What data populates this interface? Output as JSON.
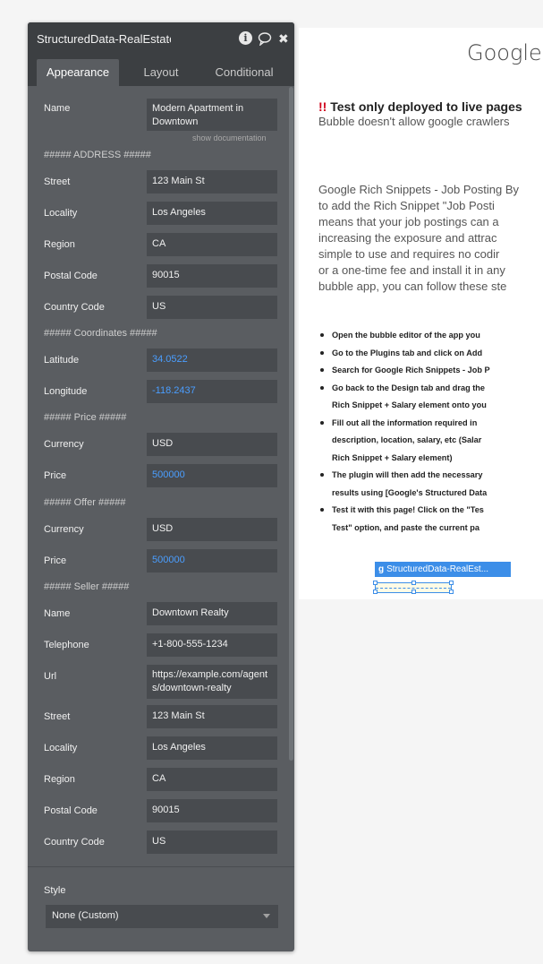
{
  "panel": {
    "title": "StructuredData-RealEstate",
    "tabs": [
      "Appearance",
      "Layout",
      "Conditional"
    ],
    "show_doc": "show documentation",
    "sections": {
      "address": "##### ADDRESS #####",
      "coordinates": "##### Coordinates #####",
      "price": "##### Price #####",
      "offer": "##### Offer #####",
      "seller": "##### Seller #####"
    },
    "fields": {
      "name": {
        "label": "Name",
        "value": "Modern Apartment in Downtown"
      },
      "street": {
        "label": "Street",
        "value": "123 Main St"
      },
      "locality": {
        "label": "Locality",
        "value": "Los Angeles"
      },
      "region": {
        "label": "Region",
        "value": "CA"
      },
      "postal": {
        "label": "Postal Code",
        "value": "90015"
      },
      "country": {
        "label": "Country Code",
        "value": "US"
      },
      "latitude": {
        "label": "Latitude",
        "value": "34.0522"
      },
      "longitude": {
        "label": "Longitude",
        "value": "-118.2437"
      },
      "currency": {
        "label": "Currency",
        "value": "USD"
      },
      "price": {
        "label": "Price",
        "value": "500000"
      },
      "offer_currency": {
        "label": "Currency",
        "value": "USD"
      },
      "offer_price": {
        "label": "Price",
        "value": "500000"
      },
      "seller_name": {
        "label": "Name",
        "value": "Downtown Realty"
      },
      "telephone": {
        "label": "Telephone",
        "value": "+1-800-555-1234"
      },
      "url": {
        "label": "Url",
        "value": "https://example.com/agents/downtown-realty"
      },
      "seller_street": {
        "label": "Street",
        "value": "123 Main St"
      },
      "seller_locality": {
        "label": "Locality",
        "value": "Los Angeles"
      },
      "seller_region": {
        "label": "Region",
        "value": "CA"
      },
      "seller_postal": {
        "label": "Postal Code",
        "value": "90015"
      },
      "seller_country": {
        "label": "Country Code",
        "value": "US"
      }
    },
    "style": {
      "label": "Style",
      "value": "None (Custom)"
    }
  },
  "page": {
    "title": "Google",
    "warning_mark": "!!",
    "warning": "Test only deployed to live pages",
    "note": "Bubble doesn't allow google crawlers",
    "paragraph": [
      "Google Rich Snippets - Job Posting By",
      "to add the Rich Snippet \"Job Posti",
      "means that your job postings can a",
      "increasing the exposure and attrac",
      "simple to use and requires no codir",
      "or a one-time fee and install it in any",
      "bubble app, you can follow these ste"
    ],
    "steps": [
      [
        "Open the bubble editor of the app you"
      ],
      [
        "Go to the Plugins tab and click on Add"
      ],
      [
        "Search for Google Rich Snippets - Job P"
      ],
      [
        "Go back to the Design tab and drag the",
        "Rich Snippet + Salary element onto you"
      ],
      [
        "Fill out all the information required in",
        "description, location, salary, etc (Salar",
        "Rich Snippet + Salary element)"
      ],
      [
        "The plugin will then add the necessary",
        "results using [Google's Structured Data"
      ],
      [
        "Test it with this page! Click on the \"Tes",
        "Test\" option, and paste the current pa"
      ]
    ],
    "element_tag": {
      "icon": "g",
      "label": "StructuredData-RealEst..."
    }
  }
}
